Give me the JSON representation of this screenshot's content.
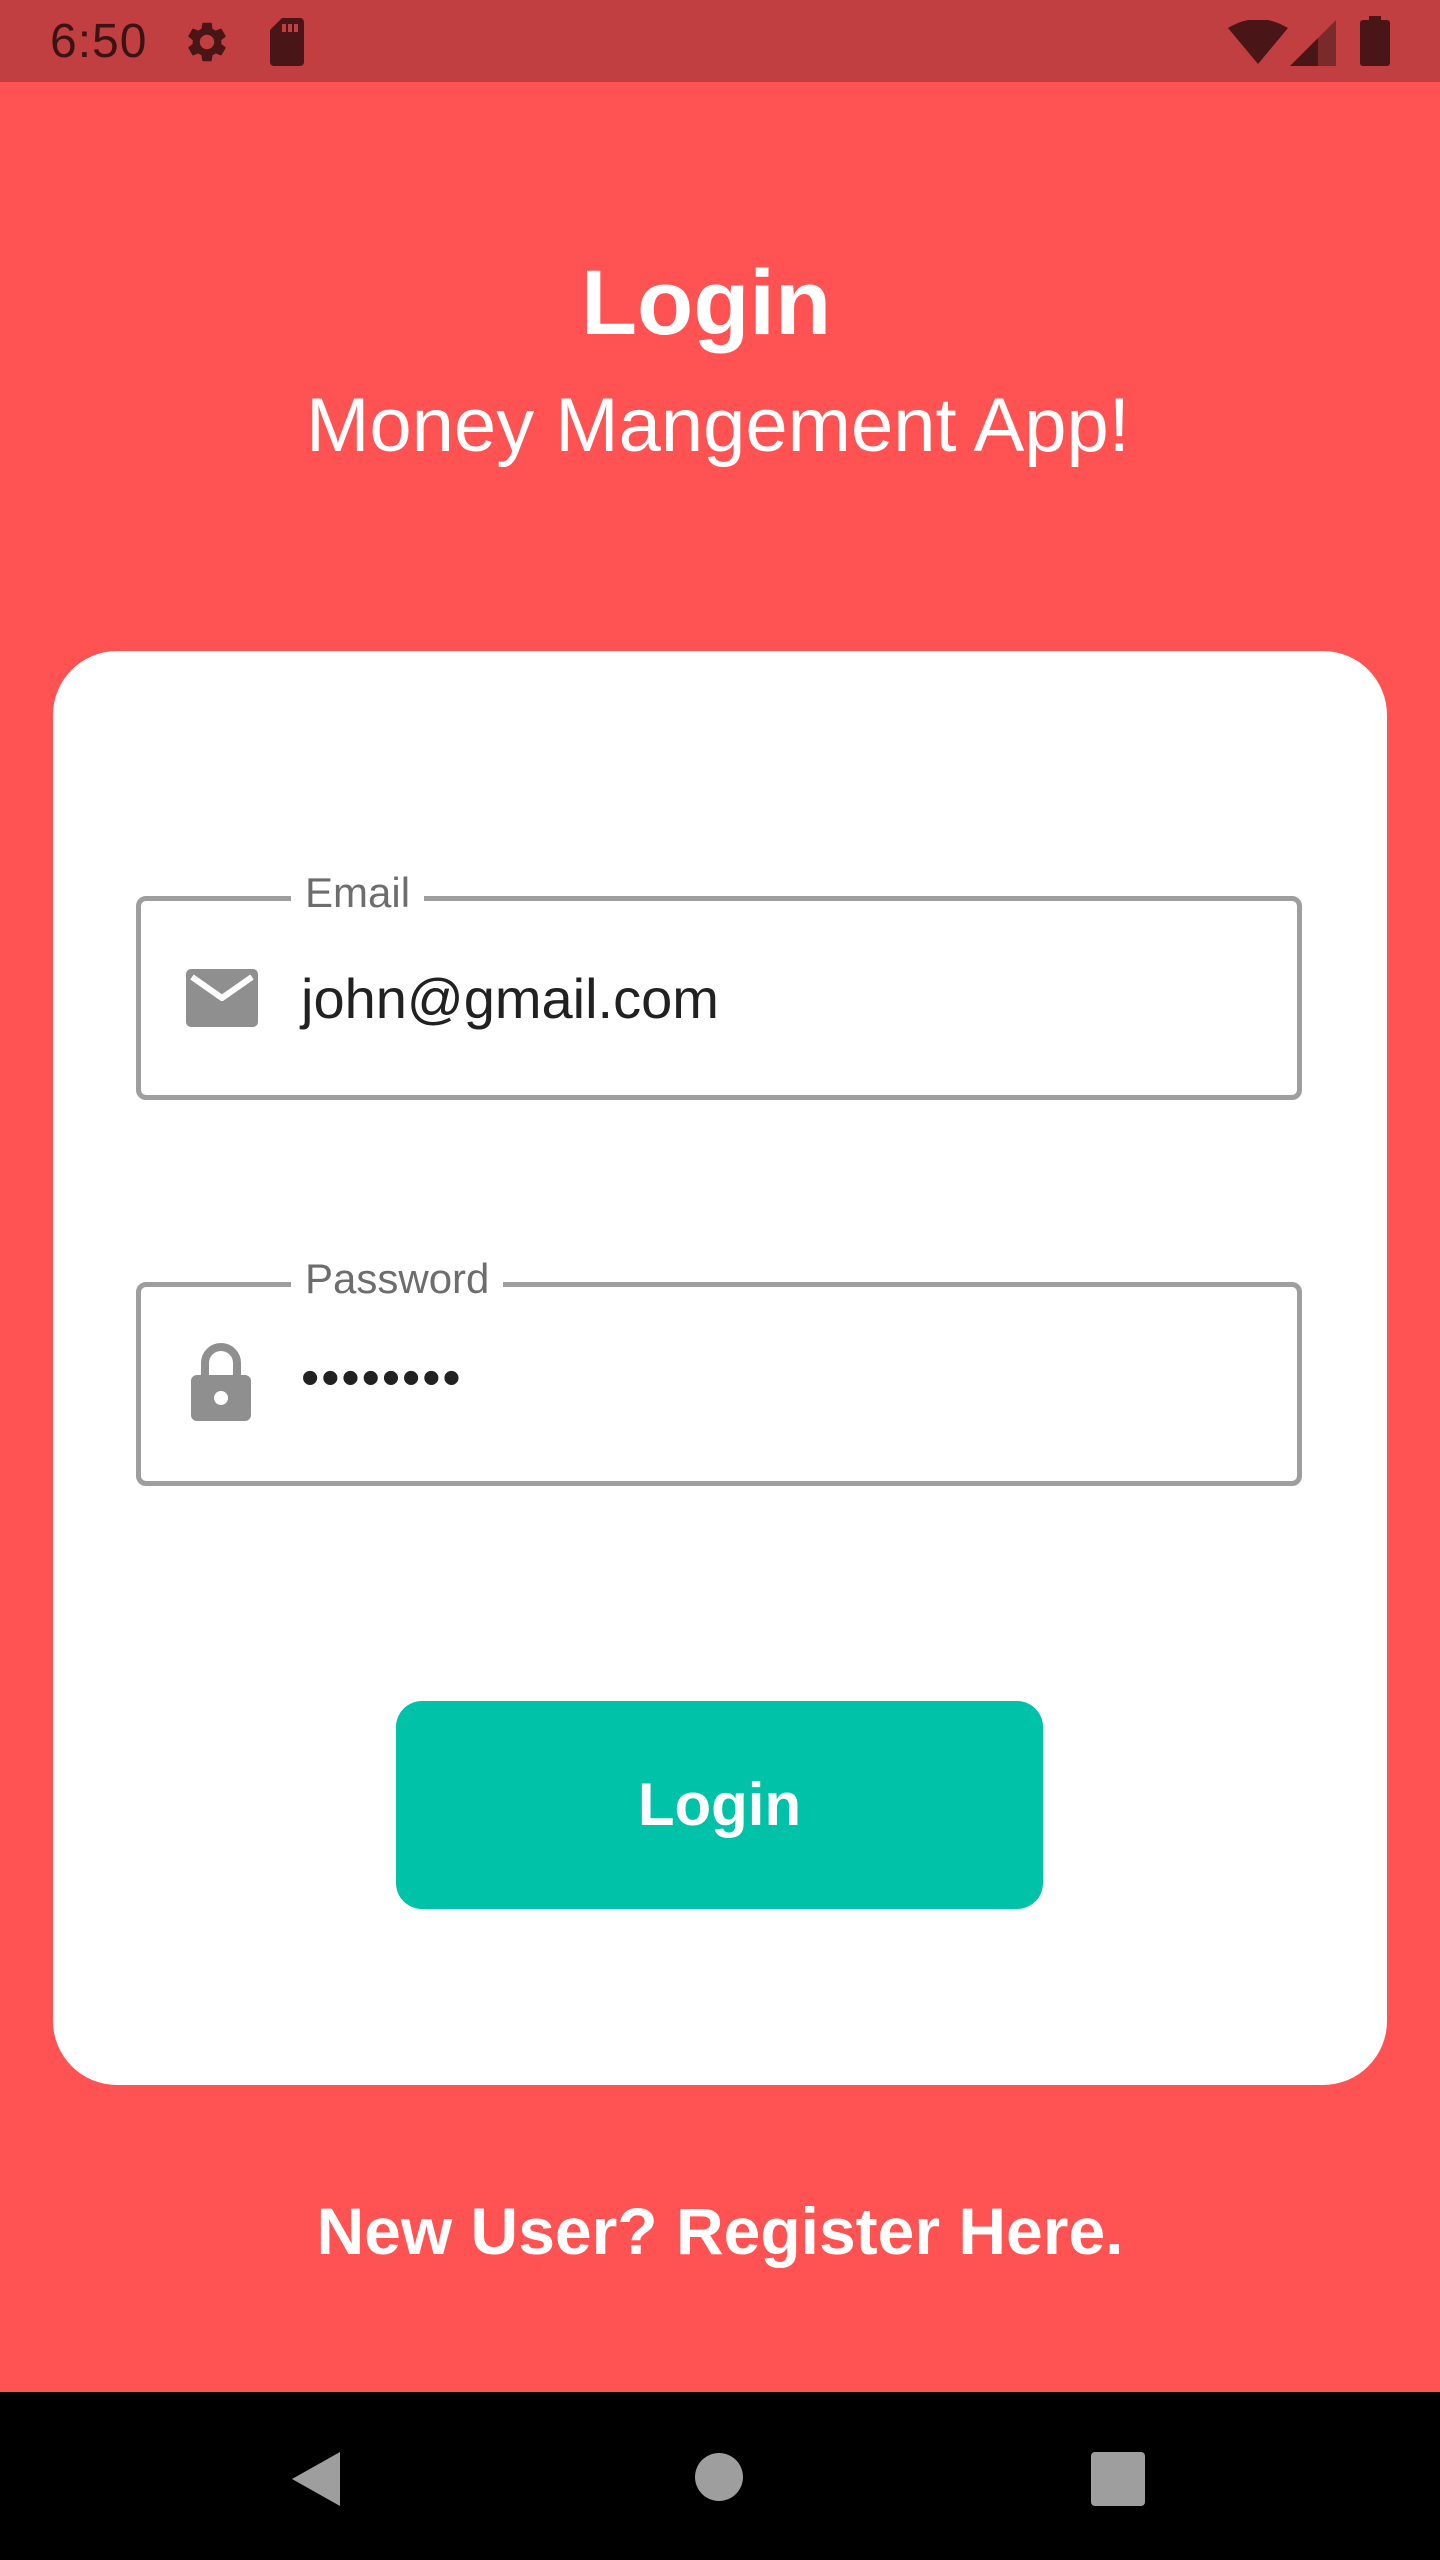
{
  "status_bar": {
    "time": "6:50"
  },
  "header": {
    "title": "Login",
    "subtitle": "Money Mangement App!"
  },
  "form": {
    "email": {
      "label": "Email",
      "value": "john@gmail.com",
      "icon": "mail-icon"
    },
    "password": {
      "label": "Password",
      "value": "••••••••",
      "icon": "lock-icon"
    },
    "login_label": "Login"
  },
  "register": {
    "label": "New User? Register Here."
  },
  "colors": {
    "background": "#FF5252",
    "status_bar": "#C13F40",
    "card": "#FFFFFF",
    "field_border": "#9E9E9E",
    "button": "#00C2A8",
    "nav_bar": "#000000"
  },
  "nav_bar": {
    "buttons": [
      "back-button",
      "home-button",
      "recents-button"
    ]
  }
}
